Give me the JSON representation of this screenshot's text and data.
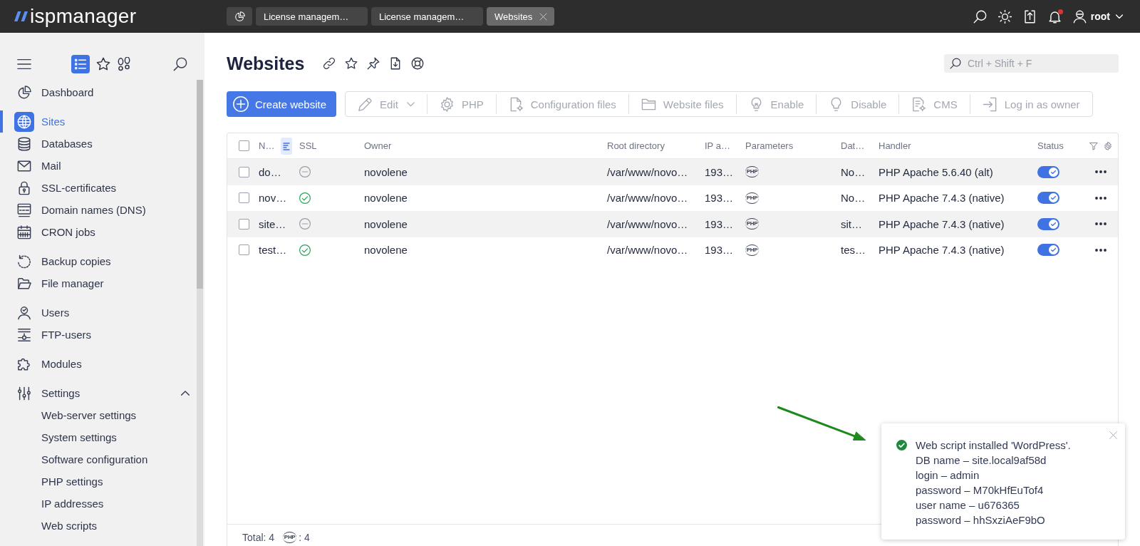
{
  "topbar": {
    "logo": "ispmanager",
    "tabs": [
      {
        "kind": "home",
        "selected": false
      },
      {
        "kind": "page",
        "label": "License managem…",
        "selected": false
      },
      {
        "kind": "page",
        "label": "License managem…",
        "selected": false
      },
      {
        "kind": "page",
        "label": "Websites",
        "selected": true
      }
    ],
    "notifications_unread": true,
    "user": "root"
  },
  "sidebar": {
    "views": [
      {
        "selected": true
      },
      {
        "selected": false
      },
      {
        "selected": false
      }
    ],
    "groups": [
      {
        "items": [
          {
            "label": "Dashboard",
            "selected": false
          }
        ]
      },
      {
        "items": [
          {
            "label": "Sites",
            "selected": true
          },
          {
            "label": "Databases",
            "selected": false
          },
          {
            "label": "Mail",
            "selected": false
          },
          {
            "label": "SSL-certificates",
            "selected": false
          },
          {
            "label": "Domain names (DNS)",
            "selected": false
          },
          {
            "label": "CRON jobs",
            "selected": false
          }
        ]
      },
      {
        "items": [
          {
            "label": "Backup copies",
            "selected": false
          },
          {
            "label": "File manager",
            "selected": false
          }
        ]
      },
      {
        "items": [
          {
            "label": "Users",
            "selected": false
          },
          {
            "label": "FTP-users",
            "selected": false
          }
        ]
      },
      {
        "items": [
          {
            "label": "Modules",
            "selected": false
          }
        ]
      },
      {
        "items": [
          {
            "label": "Settings",
            "selected": false,
            "expanded": true,
            "children": [
              {
                "label": "Web-server settings",
                "selected": false
              },
              {
                "label": "System settings",
                "selected": false
              },
              {
                "label": "Software configuration",
                "selected": false
              },
              {
                "label": "PHP settings",
                "selected": false
              },
              {
                "label": "IP addresses",
                "selected": false
              },
              {
                "label": "Web scripts",
                "selected": false
              }
            ]
          }
        ]
      }
    ]
  },
  "page": {
    "title": "Websites",
    "search": {
      "placeholder": "Ctrl + Shift + F"
    }
  },
  "toolbar": [
    {
      "kind": "primary",
      "label": "Create website",
      "disabled": false
    },
    {
      "kind": "dropdown",
      "label": "Edit",
      "disabled": true
    },
    {
      "kind": "button",
      "label": "PHP",
      "disabled": true
    },
    {
      "kind": "button",
      "label": "Configuration files",
      "disabled": true
    },
    {
      "kind": "button",
      "label": "Website files",
      "disabled": true
    },
    {
      "kind": "button",
      "label": "Enable",
      "disabled": true
    },
    {
      "kind": "button",
      "label": "Disable",
      "disabled": true
    },
    {
      "kind": "button",
      "label": "CMS",
      "disabled": true
    },
    {
      "kind": "button",
      "label": "Log in as owner",
      "disabled": true
    }
  ],
  "table": {
    "all_selected": false,
    "columns": [
      {
        "label": "N…",
        "sorted": true
      },
      {
        "label": "SSL",
        "sorted": false
      },
      {
        "label": "Owner",
        "sorted": false
      },
      {
        "label": "Root directory",
        "sorted": false
      },
      {
        "label": "IP a…",
        "sorted": false
      },
      {
        "label": "Parameters",
        "sorted": false
      },
      {
        "label": "Dat…",
        "sorted": false
      },
      {
        "label": "Handler",
        "sorted": false
      },
      {
        "label": "Status",
        "sorted": false
      }
    ],
    "rows": [
      {
        "selected": false,
        "column_1": "do…",
        "ssl_valid": false,
        "owner": "novolene",
        "root_directory": "/var/www/novo…",
        "column_5": "193…",
        "parameters": "PHP",
        "column_7": "No…",
        "handler": "PHP Apache 5.6.40 (alt)",
        "status_on": true
      },
      {
        "selected": false,
        "column_1": "nov…",
        "ssl_valid": true,
        "owner": "novolene",
        "root_directory": "/var/www/novo…",
        "column_5": "193…",
        "parameters": "PHP",
        "column_7": "No…",
        "handler": "PHP Apache 7.4.3 (native)",
        "status_on": true
      },
      {
        "selected": false,
        "column_1": "site…",
        "ssl_valid": false,
        "owner": "novolene",
        "root_directory": "/var/www/novo…",
        "column_5": "193…",
        "parameters": "PHP",
        "column_7": "sit…",
        "handler": "PHP Apache 7.4.3 (native)",
        "status_on": true
      },
      {
        "selected": false,
        "column_1": "test…",
        "ssl_valid": true,
        "owner": "novolene",
        "root_directory": "/var/www/novo…",
        "column_5": "193…",
        "parameters": "PHP",
        "column_7": "tes…",
        "handler": "PHP Apache 7.4.3 (native)",
        "status_on": true
      }
    ],
    "footer": {
      "total": "Total: 4",
      "php_label": "PHP",
      "php_count": ": 4"
    }
  },
  "notification": {
    "kind": "success",
    "lines": [
      "Web script installed 'WordPress'.",
      "DB name – site.local9af58d",
      "login – admin",
      "password – M70kHfEuTof4",
      "user name – u676365",
      "password – hhSxziAeF9bO"
    ]
  },
  "annotations": [
    {
      "kind": "arrow"
    }
  ]
}
